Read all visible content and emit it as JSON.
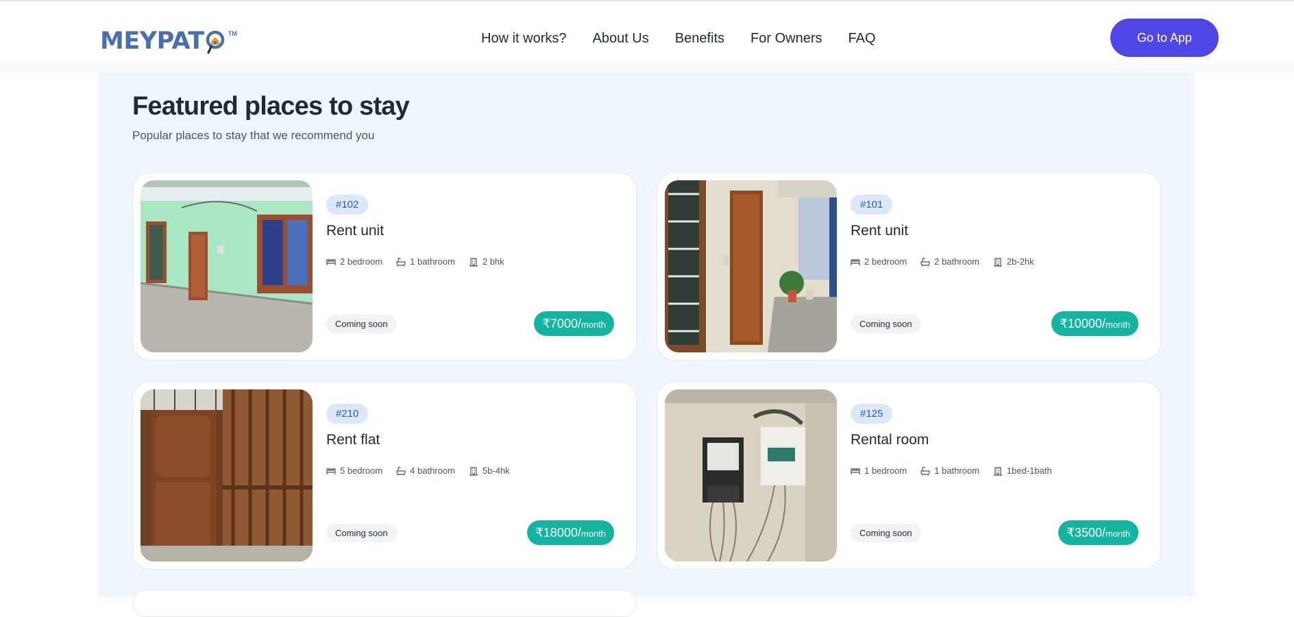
{
  "header": {
    "logo_text_before": "MEYPAT",
    "logo_tm": "TM",
    "nav": [
      "How it works?",
      "About Us",
      "Benefits",
      "For Owners",
      "FAQ"
    ],
    "cta_label": "Go to App"
  },
  "section": {
    "title": "Featured places to stay",
    "subtitle": "Popular places to stay that we recommend you"
  },
  "colors": {
    "brand_blue": "#4a6fb0",
    "cta": "#4f46e5",
    "price_badge": "#14b5a0",
    "section_bg": "#f0f6fe"
  },
  "listings": [
    {
      "id": "#102",
      "title": "Rent unit",
      "bedrooms": "2 bedroom",
      "bathrooms": "1 bathroom",
      "config": "2 bhk",
      "status": "Coming soon",
      "price": "₹7000/",
      "unit": "month",
      "photo": "green-wall-corridor"
    },
    {
      "id": "#101",
      "title": "Rent unit",
      "bedrooms": "2 bedroom",
      "bathrooms": "2 bathroom",
      "config": "2b-2hk",
      "status": "Coming soon",
      "price": "₹10000/",
      "unit": "month",
      "photo": "corridor-wooden-door"
    },
    {
      "id": "#210",
      "title": "Rent flat",
      "bedrooms": "5 bedroom",
      "bathrooms": "4 bathroom",
      "config": "5b-4hk",
      "status": "Coming soon",
      "price": "₹18000/",
      "unit": "month",
      "photo": "wooden-door-grille"
    },
    {
      "id": "#125",
      "title": "Rental room",
      "bedrooms": "1 bedroom",
      "bathrooms": "1 bathroom",
      "config": "1bed-1bath",
      "status": "Coming soon",
      "price": "₹3500/",
      "unit": "month",
      "photo": "electric-meter-wall"
    }
  ],
  "icons": {
    "bedroom": "bed-icon",
    "bathroom": "bathtub-icon",
    "config": "building-icon"
  }
}
